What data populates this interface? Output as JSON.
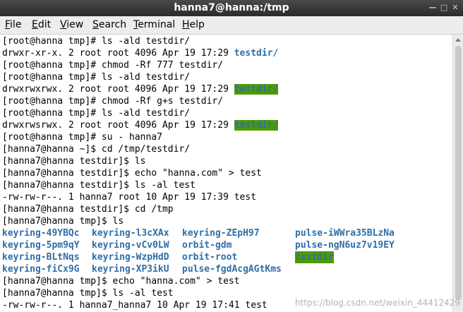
{
  "window": {
    "title": "hanna7@hanna:/tmp"
  },
  "menu": [
    {
      "mn": "F",
      "rest": "ile"
    },
    {
      "mn": "E",
      "rest": "dit"
    },
    {
      "mn": "V",
      "rest": "iew"
    },
    {
      "mn": "S",
      "rest": "earch"
    },
    {
      "mn": "T",
      "rest": "erminal"
    },
    {
      "mn": "H",
      "rest": "elp"
    }
  ],
  "terminal": {
    "lines": [
      "[root@hanna tmp]# ls -ald testdir/",
      "drwxr-xr-x. 2 root root 4096 Apr 19 17:29 ",
      "[root@hanna tmp]# chmod -Rf 777 testdir/",
      "drwxrwxrwx. 2 root root 4096 Apr 19 17:29 ",
      "[root@hanna tmp]# ls -ald testdir/",
      "drwxrwxrwx. 2 root root 4096 Apr 19 17:29 ",
      "[root@hanna tmp]# chmod -Rf g+s testdir/",
      "[root@hanna tmp]# ls -ald testdir/",
      "drwxrwsrwx. 2 root root 4096 Apr 19 17:29 ",
      "[root@hanna tmp]# su - hanna7",
      "[hanna7@hanna ~]$ cd /tmp/testdir/",
      "[hanna7@hanna testdir]$ ls",
      "[hanna7@hanna testdir]$ echo \"hanna.com\" > test",
      "[hanna7@hanna testdir]$ ls -al test",
      "-rw-rw-r--. 1 hanna7 root 10 Apr 19 17:39 test",
      "[hanna7@hanna testdir]$ cd /tmp",
      "[hanna7@hanna tmp]$ ls",
      "[hanna7@hanna tmp]$ echo \"hanna.com\" > test",
      "[hanna7@hanna tmp]$ ls -al test",
      "-rw-rw-r--. 1 hanna7_hanna7 10 Apr 19 17:41 test"
    ],
    "dir_names": [
      "testdir/",
      "testdir/",
      "testdir/"
    ],
    "ls_grid": [
      [
        "keyring-49YBQc",
        "keyring-l3cXAx",
        "keyring-ZEpH97",
        "pulse-iWWra35BLzNa"
      ],
      [
        "keyring-5pm9qY",
        "keyring-vCv0LW",
        "orbit-gdm",
        "pulse-ngN6uz7v19EY"
      ],
      [
        "keyring-BLtNqs",
        "keyring-WzpHdD",
        "orbit-root",
        "testdir"
      ],
      [
        "keyring-fiCx9G",
        "keyring-XP3ikU",
        "pulse-fgdAcgAGtKms",
        ""
      ]
    ]
  },
  "watermark": "https://blog.csdn.net/weixin_44412429"
}
